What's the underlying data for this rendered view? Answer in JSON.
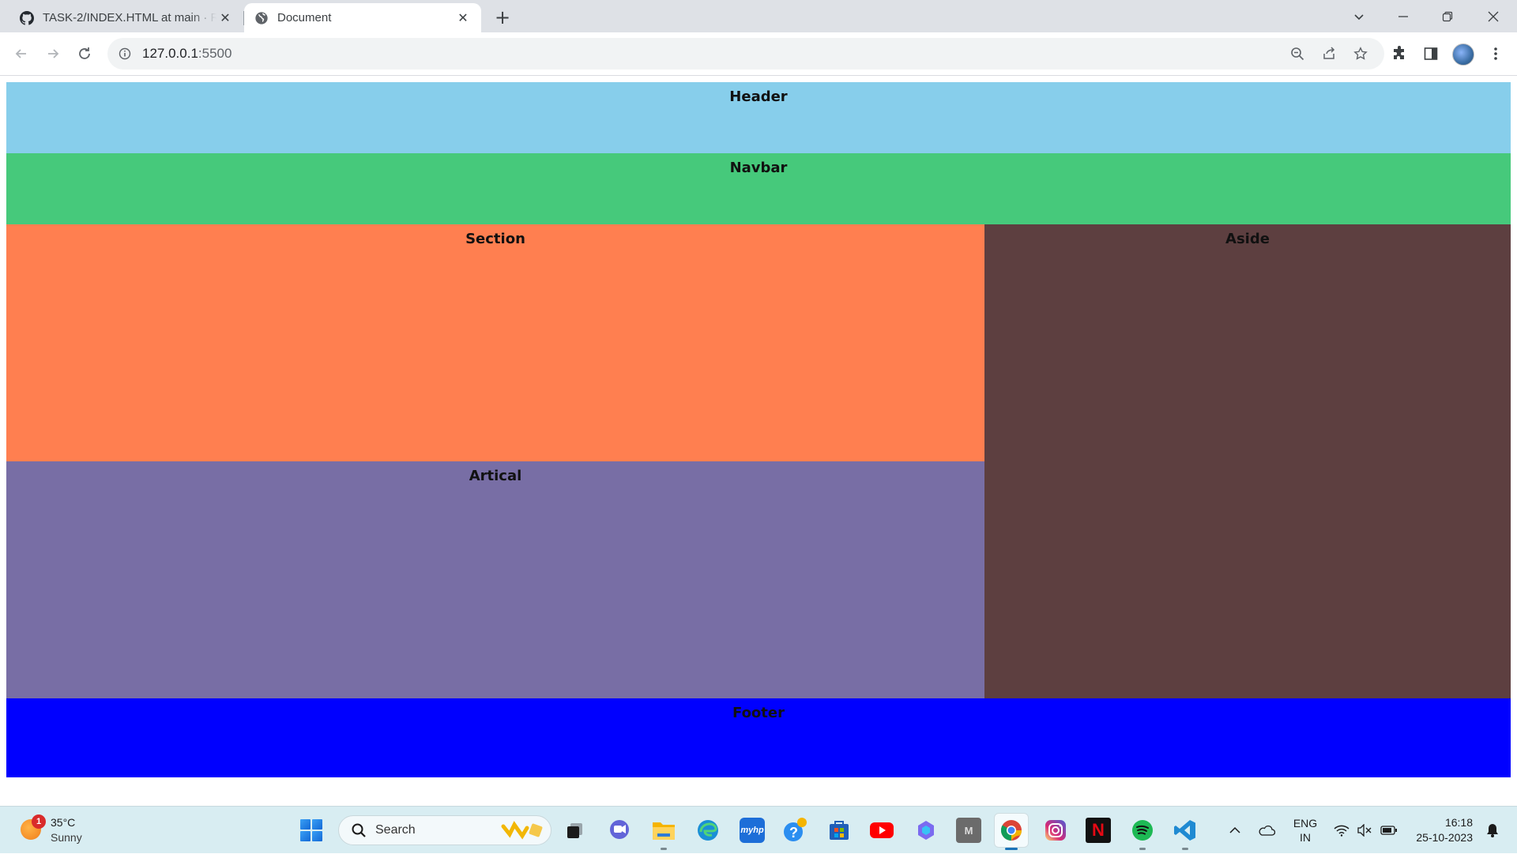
{
  "browser": {
    "tabs": [
      {
        "title": "TASK-2/INDEX.HTML at main · R",
        "icon": "github-icon",
        "active": false
      },
      {
        "title": "Document",
        "icon": "globe-icon",
        "active": true
      }
    ],
    "new_tab_label": "+",
    "address": {
      "host": "127.0.0.1",
      "port": ":5500"
    }
  },
  "page": {
    "header": "Header",
    "navbar": "Navbar",
    "section": "Section",
    "aside": "Aside",
    "article": "Artical",
    "footer": "Footer",
    "colors": {
      "header": "#87ceeb",
      "navbar": "#46c97b",
      "section": "#ff7f50",
      "aside": "#5d3f40",
      "article": "#786ea5",
      "footer": "#0000ff"
    }
  },
  "taskbar": {
    "weather": {
      "temp": "35°C",
      "condition": "Sunny",
      "badge": "1"
    },
    "search_label": "Search",
    "apps": [
      "task-view",
      "teams-chat",
      "file-explorer",
      "edge",
      "myhp",
      "get-help",
      "microsoft-store",
      "youtube",
      "copilot",
      "m-app",
      "chrome",
      "instagram",
      "netflix",
      "spotify",
      "vscode"
    ],
    "lang": {
      "line1": "ENG",
      "line2": "IN"
    },
    "clock": {
      "time": "16:18",
      "date": "25-10-2023"
    }
  }
}
